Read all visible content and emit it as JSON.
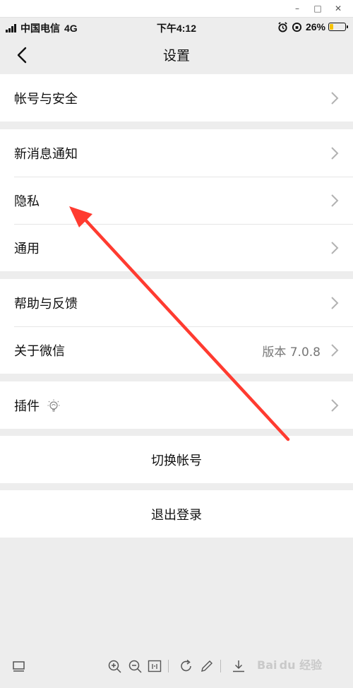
{
  "window_controls": {
    "minimize": "–",
    "maximize": "□",
    "close": "✕"
  },
  "status_bar": {
    "carrier": "中国电信",
    "network": "4G",
    "time": "下午4:12",
    "battery_percent": "26%",
    "battery_level": 0.26
  },
  "nav": {
    "title": "设置",
    "back_icon": "chevron-left-icon"
  },
  "groups": [
    {
      "items": [
        {
          "label": "帐号与安全"
        }
      ]
    },
    {
      "items": [
        {
          "label": "新消息通知"
        },
        {
          "label": "隐私"
        },
        {
          "label": "通用"
        }
      ]
    },
    {
      "items": [
        {
          "label": "帮助与反馈"
        },
        {
          "label": "关于微信",
          "value": "版本 7.0.8"
        }
      ]
    },
    {
      "items": [
        {
          "label": "插件",
          "icon": "lightbulb-icon"
        }
      ]
    }
  ],
  "actions": {
    "switch_account": "切换帐号",
    "logout": "退出登录"
  },
  "annotation": {
    "arrow_color": "#ff3b30",
    "arrow_target": "隐私"
  },
  "watermark": {
    "text": "Bai du 经验"
  },
  "toolbar_icons": [
    "thumbnail-icon",
    "zoom-in-icon",
    "zoom-out-icon",
    "actual-size-icon",
    "rotate-icon",
    "edit-icon",
    "download-icon"
  ]
}
